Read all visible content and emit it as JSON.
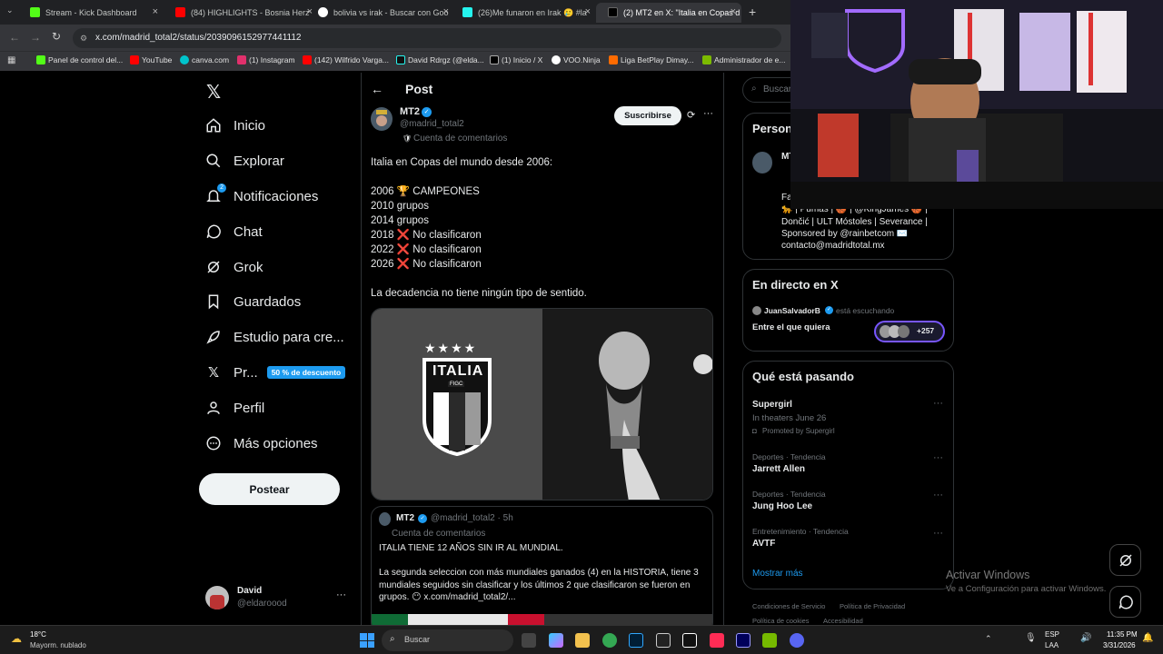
{
  "browser": {
    "tabs": [
      {
        "label": "Stream - Kick Dashboard",
        "color": "#53fc18"
      },
      {
        "label": "(84) HIGHLIGHTS - Bosnia Herz",
        "color": "#ff0000"
      },
      {
        "label": "bolivia vs irak - Buscar con Goo",
        "color": "#ffffff"
      },
      {
        "label": "(26)Me funaron en Irak 🥲 #la",
        "color": "#25f4ee"
      },
      {
        "label": "(2) MT2 en X: \"Italia en Copas d",
        "color": "#ffffff"
      }
    ],
    "new_tab": "+",
    "url": "x.com/madrid_total2/status/2039096152977441112",
    "bookmarks": [
      {
        "label": "Panel de control del...",
        "color": "#53fc18"
      },
      {
        "label": "YouTube",
        "color": "#ff0000"
      },
      {
        "label": "canva.com",
        "color": "#00c4cc"
      },
      {
        "label": "(1) Instagram",
        "color": "#e1306c"
      },
      {
        "label": "(142) Wilfrido Varga...",
        "color": "#ff0000"
      },
      {
        "label": "David Rdrgz (@elda...",
        "color": "#ffffff"
      },
      {
        "label": "(1) Inicio / X",
        "color": "#ffffff"
      },
      {
        "label": "VOO.Ninja",
        "color": "#ffffff"
      },
      {
        "label": "Liga BetPlay Dimay...",
        "color": "#ff6b00"
      },
      {
        "label": "Administrador de e...",
        "color": "#7cbb00"
      }
    ]
  },
  "nav": {
    "items": [
      {
        "label": "Inicio",
        "icon": "home-icon"
      },
      {
        "label": "Explorar",
        "icon": "search-icon"
      },
      {
        "label": "Notificaciones",
        "icon": "bell-icon"
      },
      {
        "label": "Chat",
        "icon": "chat-icon"
      },
      {
        "label": "Grok",
        "icon": "grok-icon"
      },
      {
        "label": "Guardados",
        "icon": "bookmark-icon"
      },
      {
        "label": "Estudio para cre...",
        "icon": "rocket-icon"
      },
      {
        "label": "Pr...",
        "icon": "x-icon"
      },
      {
        "label": "Perfil",
        "icon": "person-icon"
      },
      {
        "label": "Más opciones",
        "icon": "more-icon"
      }
    ],
    "notif_badge": "2",
    "premium_badge": "50 % de descuento",
    "post_button": "Postear",
    "account": {
      "name": "David",
      "handle": "@eldaroood",
      "more": "···"
    }
  },
  "post": {
    "header": "Post",
    "author": "MT2",
    "handle": "@madrid_total2",
    "account_type": "Cuenta de comentarios",
    "subscribe": "Suscribirse",
    "more": "···",
    "lines": [
      "Italia en Copas del mundo desde 2006:",
      "",
      "2006 🏆 CAMPEONES",
      "2010 grupos",
      "2014 grupos",
      "2018 ❌ No clasificaron",
      "2022 ❌ No clasificaron",
      "2026 ❌ No clasificaron",
      "",
      "La decadencia no tiene ningún tipo de sentido."
    ],
    "image": {
      "crest_text": "ITALIA",
      "crest_sub": "FIGC"
    },
    "quote": {
      "author": "MT2",
      "handle": "@madrid_total2 · 5h",
      "account_type": "Cuenta de comentarios",
      "text1": "ITALIA TIENE 12 AÑOS SIN IR AL MUNDIAL.",
      "text2": "La segunda seleccion con más mundiales ganados (4) en la HISTORIA, tiene 3 mundiales seguidos sin clasificar y los últimos 2 que clasificaron se fueron en grupos. 😶 x.com/madrid_total2/..."
    }
  },
  "right": {
    "search_placeholder": "Buscar",
    "profile_card": {
      "title": "Person",
      "name": "MT",
      "bio1": "Fa",
      "bio2": "🐆 | Pumas | 🏀 | @KingJames 🏀 |",
      "bio3": "Dončić | ULT Móstoles | Severance |",
      "bio4": "Sponsored by @rainbetcom ✉️",
      "bio5": "contacto@madridtotal.mx"
    },
    "live": {
      "title": "En directo en X",
      "host": "JuanSalvadorB",
      "status": "está escuchando",
      "space": "Entre el que quiera",
      "count": "+257"
    },
    "trends": {
      "title": "Qué está pasando",
      "items": [
        {
          "context": "",
          "name": "Supergirl",
          "sub": "In theaters June 26",
          "promo": "Promoted by Supergirl"
        },
        {
          "context": "Deportes · Tendencia",
          "name": "Jarrett Allen"
        },
        {
          "context": "Deportes · Tendencia",
          "name": "Jung Hoo Lee"
        },
        {
          "context": "Entretenimiento · Tendencia",
          "name": "AVTF"
        }
      ],
      "show_more": "Mostrar más"
    },
    "footer": {
      "links1": [
        "Condiciones de Servicio",
        "Política de Privacidad"
      ],
      "links2": [
        "Política de cookies",
        "Accesibilidad"
      ]
    }
  },
  "windows_watermark": {
    "line1": "Activar Windows",
    "line2": "Ve a Configuración para activar Windows."
  },
  "taskbar": {
    "weather_temp": "18°C",
    "weather_desc": "Mayorm. nublado",
    "search": "Buscar",
    "lang1": "ESP",
    "lang2": "LAA",
    "time": "11:35 PM",
    "date": "3/31/2026"
  }
}
